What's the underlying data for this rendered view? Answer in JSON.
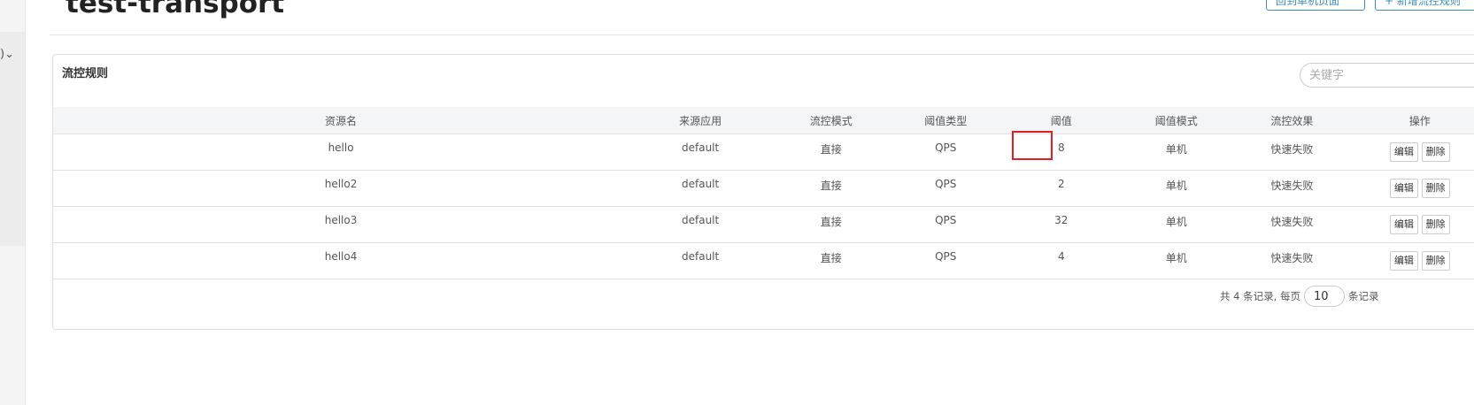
{
  "sidebar": {
    "chevron": ")⌄"
  },
  "header": {
    "title": "test-transport",
    "buttons": [
      "回到单机页面",
      "+ 新增流控规则"
    ]
  },
  "panel": {
    "title": "流控规则",
    "search_placeholder": "关键字"
  },
  "table": {
    "columns": [
      "资源名",
      "来源应用",
      "流控模式",
      "阈值类型",
      "阈值",
      "阈值模式",
      "流控效果",
      "操作"
    ],
    "rows": [
      {
        "resource": "hello",
        "origin": "default",
        "mode": "直接",
        "grade": "QPS",
        "count": "8",
        "cluster": "单机",
        "effect": "快速失败",
        "edit": "编辑",
        "delete": "删除"
      },
      {
        "resource": "hello2",
        "origin": "default",
        "mode": "直接",
        "grade": "QPS",
        "count": "2",
        "cluster": "单机",
        "effect": "快速失败",
        "edit": "编辑",
        "delete": "删除"
      },
      {
        "resource": "hello3",
        "origin": "default",
        "mode": "直接",
        "grade": "QPS",
        "count": "32",
        "cluster": "单机",
        "effect": "快速失败",
        "edit": "编辑",
        "delete": "删除"
      },
      {
        "resource": "hello4",
        "origin": "default",
        "mode": "直接",
        "grade": "QPS",
        "count": "4",
        "cluster": "单机",
        "effect": "快速失败",
        "edit": "编辑",
        "delete": "删除"
      }
    ]
  },
  "pager": {
    "summary": "共 4 条记录, 每页",
    "page_size": "10",
    "suffix": "条记录"
  },
  "colors": {
    "accent": "#3c8dbc",
    "highlight": "#e02020"
  }
}
